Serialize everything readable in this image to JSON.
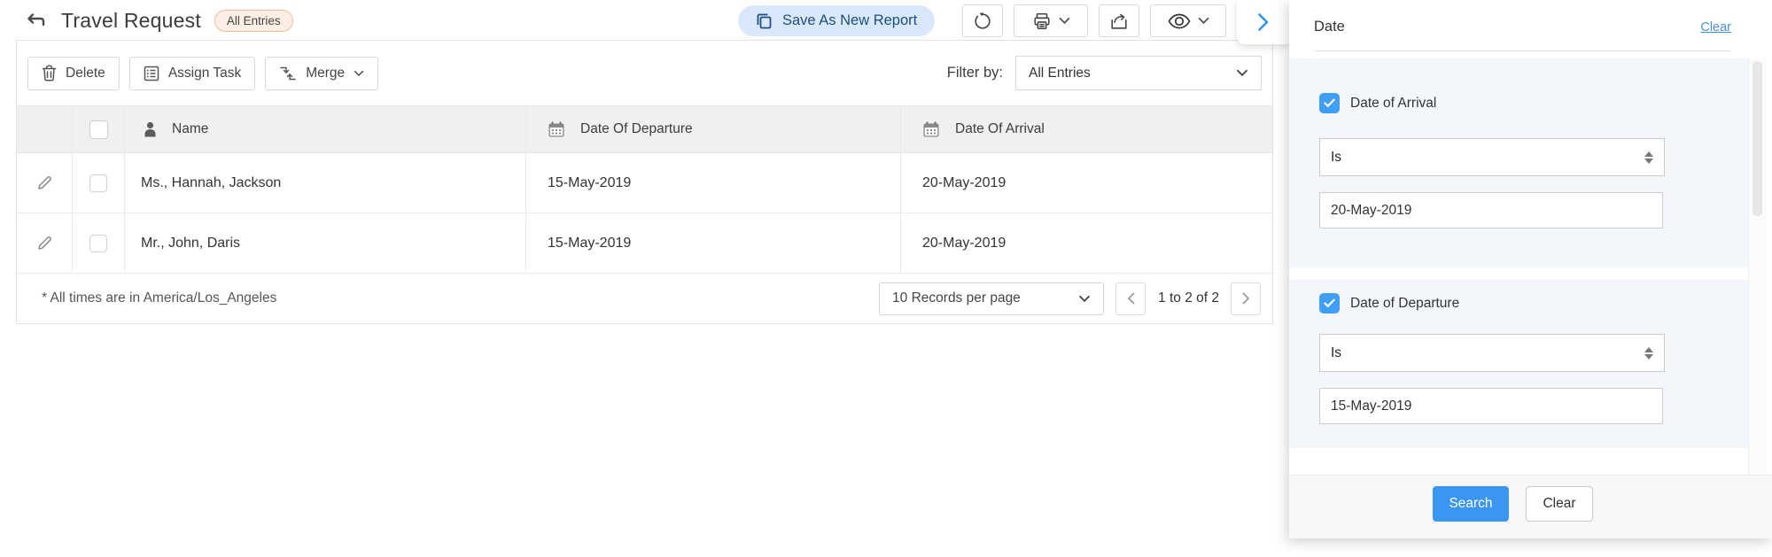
{
  "header": {
    "title": "Travel Request",
    "badge": "All Entries",
    "save_button": "Save As New Report"
  },
  "toolbar": {
    "delete": "Delete",
    "assign_task": "Assign Task",
    "merge": "Merge",
    "filter_by": "Filter by:",
    "filter_value": "All Entries"
  },
  "table": {
    "columns": [
      "Name",
      "Date Of Departure",
      "Date Of Arrival"
    ],
    "rows": [
      {
        "name": "Ms., Hannah, Jackson",
        "departure": "15-May-2019",
        "arrival": "20-May-2019"
      },
      {
        "name": "Mr., John, Daris",
        "departure": "15-May-2019",
        "arrival": "20-May-2019"
      }
    ],
    "footnote": "* All times are in America/Los_Angeles",
    "records_per_page": "10 Records per page",
    "page_info": "1 to 2 of 2"
  },
  "panel": {
    "title": "Date",
    "clear_link": "Clear",
    "filters": [
      {
        "label": "Date of Arrival",
        "checked": true,
        "operator": "Is",
        "value": "20-May-2019"
      },
      {
        "label": "Date of Departure",
        "checked": true,
        "operator": "Is",
        "value": "15-May-2019"
      }
    ],
    "search": "Search",
    "clear": "Clear"
  },
  "icons": {
    "header": [
      "back-arrow",
      "copy",
      "refresh",
      "printer",
      "export",
      "eye",
      "chevron-right"
    ],
    "toolbar": [
      "trash",
      "task-list",
      "merge-arrows"
    ],
    "table": [
      "person",
      "calendar",
      "pencil",
      "checkbox"
    ]
  },
  "colors": {
    "accent_blue": "#3b96f2",
    "checkbox_blue": "#3f9ef5",
    "link_blue": "#4a90e2",
    "save_pill_bg": "#d9e9fb",
    "save_pill_text": "#1d4e7d",
    "badge_bg": "#fdeee6",
    "badge_border": "#f2bb9b",
    "section_bg": "#f3f6fb",
    "table_header_bg": "#f0f0f0"
  }
}
